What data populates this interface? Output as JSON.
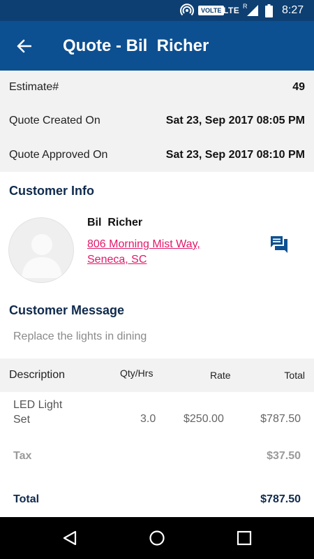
{
  "status_bar": {
    "volte": "VOLTE",
    "network": "LTE",
    "roaming": "R",
    "time": "8:27"
  },
  "app_bar": {
    "title": "Quote - Bil  Richer"
  },
  "summary": {
    "estimate_label": "Estimate#",
    "estimate_value": "49",
    "created_label": "Quote Created On",
    "created_value": "Sat 23, Sep 2017 08:05 PM",
    "approved_label": "Quote Approved On",
    "approved_value": "Sat 23, Sep 2017 08:10 PM"
  },
  "customer_info": {
    "heading": "Customer Info",
    "name": "Bil  Richer",
    "address_line1": "806 Morning Mist Way,",
    "address_line2": "Seneca, SC"
  },
  "customer_message": {
    "heading": "Customer Message",
    "text": "Replace the lights in dining"
  },
  "table": {
    "headers": {
      "description": "Description",
      "qty": "Qty/Hrs",
      "rate": "Rate",
      "total": "Total"
    },
    "items": [
      {
        "description_line1": "LED Light",
        "description_line2": "Set",
        "qty": "3.0",
        "rate": "$250.00",
        "total": "$787.50"
      }
    ],
    "tax_label": "Tax",
    "tax_value": "$37.50",
    "total_label": "Total",
    "total_value": "$787.50"
  },
  "colors": {
    "status_bar": "#0d3f72",
    "app_bar": "#0d5091",
    "address_link": "#e0196a",
    "heading": "#0f2a4d"
  },
  "icons": {
    "back": "arrow-back-icon",
    "chat": "chat-icon",
    "nav_back": "triangle-back-icon",
    "nav_home": "circle-home-icon",
    "nav_recent": "square-recent-icon"
  }
}
